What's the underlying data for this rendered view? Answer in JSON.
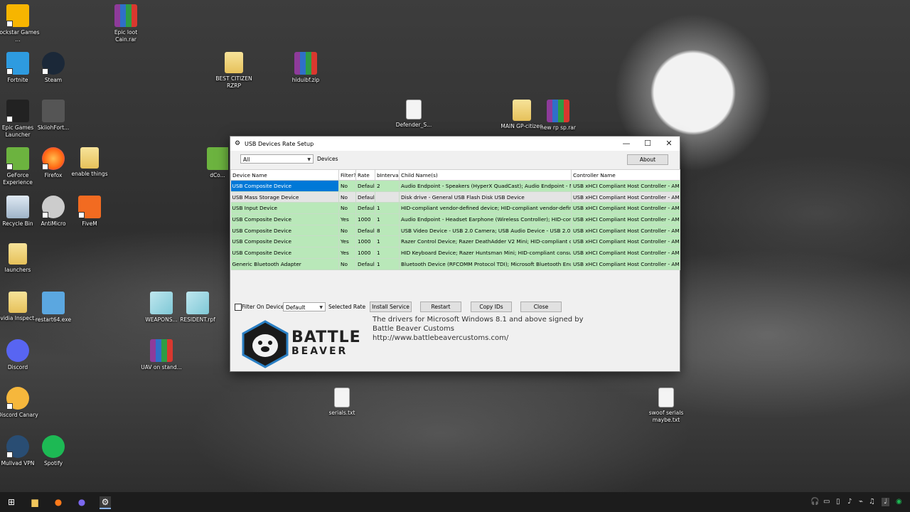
{
  "desktop": {
    "icons": [
      {
        "label": "Rockstar Games ...",
        "icon": "rockstar-icon"
      },
      {
        "label": "Epic loot Cain.rar",
        "icon": "winrar-icon"
      },
      {
        "label": "Fortnite",
        "icon": "fortnite-icon"
      },
      {
        "label": "Steam",
        "icon": "steam-icon"
      },
      {
        "label": "BEST CITIZEN RZRP",
        "icon": "folder-icon"
      },
      {
        "label": "hiduibf.zip",
        "icon": "winrar-icon"
      },
      {
        "label": "Epic Games Launcher",
        "icon": "epic-games-icon"
      },
      {
        "label": "SkiiohFort...",
        "icon": "image-icon"
      },
      {
        "label": "Defender_S...",
        "icon": "script-icon"
      },
      {
        "label": "MAIN GP-citizen",
        "icon": "folder-icon"
      },
      {
        "label": "new rp sp.rar",
        "icon": "winrar-icon"
      },
      {
        "label": "GeForce Experience",
        "icon": "nvidia-icon"
      },
      {
        "label": "Firefox",
        "icon": "firefox-icon"
      },
      {
        "label": "enable things",
        "icon": "folder-icon"
      },
      {
        "label": "dCo...",
        "icon": "app-icon"
      },
      {
        "label": "Recycle Bin",
        "icon": "recycle-bin-icon"
      },
      {
        "label": "AntiMicro",
        "icon": "gamepad-icon"
      },
      {
        "label": "FiveM",
        "icon": "fivem-icon"
      },
      {
        "label": "launchers",
        "icon": "folder-icon"
      },
      {
        "label": "Nvidia Inspect...",
        "icon": "folder-icon"
      },
      {
        "label": "restart64.exe",
        "icon": "exe-icon"
      },
      {
        "label": "WEAPONS...",
        "icon": "file-icon"
      },
      {
        "label": "RESIDENT.rpf",
        "icon": "file-icon"
      },
      {
        "label": "Discord",
        "icon": "discord-icon"
      },
      {
        "label": "UAV on stand...",
        "icon": "winrar-icon"
      },
      {
        "label": "serials.txt",
        "icon": "text-file-icon"
      },
      {
        "label": "swoof serials maybe.txt",
        "icon": "text-file-icon"
      },
      {
        "label": "Discord Canary",
        "icon": "discord-canary-icon"
      },
      {
        "label": "Mullvad VPN",
        "icon": "mullvad-icon"
      },
      {
        "label": "Spotify",
        "icon": "spotify-icon"
      }
    ]
  },
  "window": {
    "title": "USB Devices Rate Setup",
    "filter_value": "All",
    "filter_label": "Devices",
    "about_label": "About",
    "columns": [
      "Device Name",
      "Filter?",
      "Rate",
      "bInterval",
      "Child Name(s)",
      "Controller Name"
    ],
    "rows": [
      {
        "device": "USB Composite Device",
        "filter": "No",
        "rate": "Default",
        "binterval": "2",
        "child": "Audio Endpoint - Speakers (HyperX QuadCast); Audio Endpoint - Microphone",
        "controller": "USB xHCI Compliant Host Controller - AMD USB",
        "style": "sel"
      },
      {
        "device": "USB Mass Storage Device",
        "filter": "No",
        "rate": "Default",
        "binterval": "",
        "child": "Disk drive - General USB Flash Disk USB Device",
        "controller": "USB xHCI Compliant Host Controller - AMD USB",
        "style": "gray"
      },
      {
        "device": "USB Input Device",
        "filter": "No",
        "rate": "Default",
        "binterval": "1",
        "child": "HID-compliant vendor-defined device; HID-compliant vendor-defined device",
        "controller": "USB xHCI Compliant Host Controller - AMD USB",
        "style": "green"
      },
      {
        "device": "USB Composite Device",
        "filter": "Yes",
        "rate": "1000",
        "binterval": "1",
        "child": "Audio Endpoint - Headset Earphone (Wireless Controller); HID-compliant game",
        "controller": "USB xHCI Compliant Host Controller - AMD USB",
        "style": "green"
      },
      {
        "device": "USB Composite Device",
        "filter": "No",
        "rate": "Default",
        "binterval": "8",
        "child": "USB Video Device - USB 2.0 Camera; USB Audio Device - USB 2.0 Camera",
        "controller": "USB xHCI Compliant Host Controller - AMD USB",
        "style": "green"
      },
      {
        "device": "USB Composite Device",
        "filter": "Yes",
        "rate": "1000",
        "binterval": "1",
        "child": "Razer Control Device; Razer DeathAdder V2 Mini; HID-compliant consumer",
        "controller": "USB xHCI Compliant Host Controller - AMD USB",
        "style": "green"
      },
      {
        "device": "USB Composite Device",
        "filter": "Yes",
        "rate": "1000",
        "binterval": "1",
        "child": "HID Keyboard Device; Razer Huntsman Mini; HID-compliant consumer contr",
        "controller": "USB xHCI Compliant Host Controller - AMD USB",
        "style": "green"
      },
      {
        "device": "Generic Bluetooth Adapter",
        "filter": "No",
        "rate": "Default",
        "binterval": "1",
        "child": "Bluetooth Device (RFCOMM Protocol TDI); Microsoft Bluetooth Enumerator;",
        "controller": "USB xHCI Compliant Host Controller - AMD USB",
        "style": "green"
      }
    ],
    "filter_on_device_label": "Filter On Device",
    "rate_select_value": "Default",
    "selected_rate_label": "Selected Rate",
    "install_service_label": "Install Service",
    "restart_label": "Restart",
    "copy_ids_label": "Copy IDs",
    "close_label": "Close",
    "footer": {
      "brand_line1": "BATTLE",
      "brand_line2": "BEAVER",
      "text1": "The drivers for Microsoft Windows 8.1 and above signed by",
      "text2": "Battle Beaver Customs",
      "url": "http://www.battlebeavercustoms.com/"
    }
  },
  "colors": {
    "row_green": "#b9e8b9",
    "row_gray": "#e4e4e4",
    "selection": "#0078d7",
    "taskbar": "#1c1c1c"
  }
}
